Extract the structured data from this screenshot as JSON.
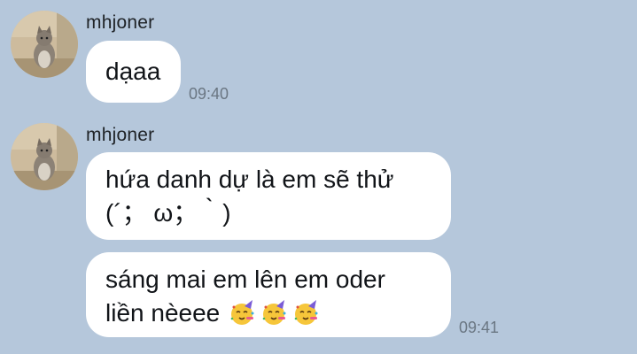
{
  "chat": {
    "groups": [
      {
        "sender": "mhjoner",
        "avatar_icon": "cat-avatar-icon",
        "messages": [
          {
            "lines": [
              "dạaa"
            ],
            "time": "09:40"
          }
        ]
      },
      {
        "sender": "mhjoner",
        "avatar_icon": "cat-avatar-icon",
        "messages": [
          {
            "lines": [
              "hứa danh dự là em sẽ thử",
              "(´； ω；｀)"
            ]
          },
          {
            "lines": [
              "sáng mai em lên em oder",
              "liền nèeee"
            ],
            "emoji": [
              "partying-face-icon",
              "partying-face-icon",
              "partying-face-icon"
            ],
            "time": "09:41"
          }
        ]
      }
    ]
  },
  "colors": {
    "background": "#b5c7db",
    "bubble": "#ffffff",
    "text": "#111418",
    "timestamp": "#6a7682"
  }
}
